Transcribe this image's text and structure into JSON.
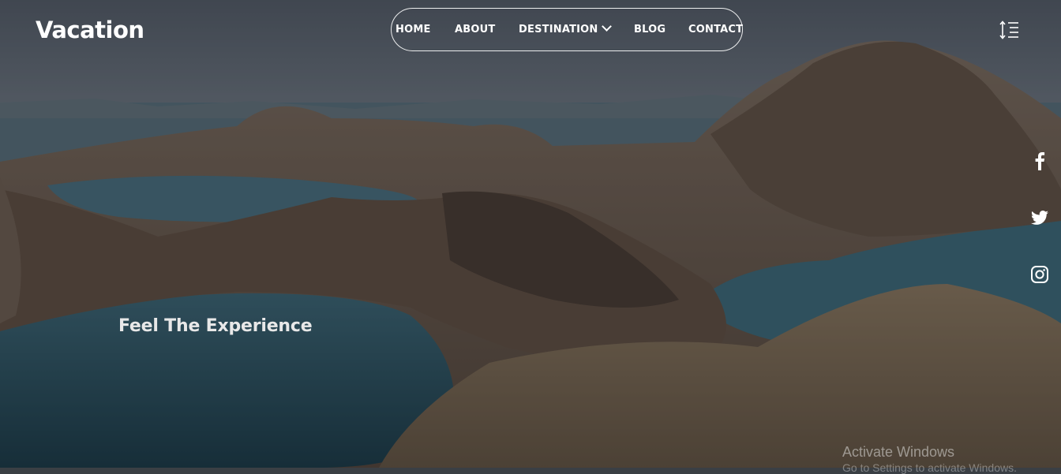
{
  "header": {
    "brand": "Vacation"
  },
  "nav": {
    "items": [
      {
        "label": "HOME"
      },
      {
        "label": "ABOUT"
      },
      {
        "label": "DESTINATION",
        "has_dropdown": true
      },
      {
        "label": "BLOG"
      },
      {
        "label": "CONTACT"
      }
    ]
  },
  "icons": {
    "menu": "sort-lines-icon",
    "social": [
      "facebook-icon",
      "twitter-icon",
      "instagram-icon"
    ]
  },
  "hero": {
    "tagline": "Feel The Experience"
  },
  "system": {
    "watermark": "Activate Windows",
    "watermark_sub": "Go to Settings to activate Windows."
  },
  "colors": {
    "text": "#ffffff",
    "overlay": "#1a1e22"
  }
}
